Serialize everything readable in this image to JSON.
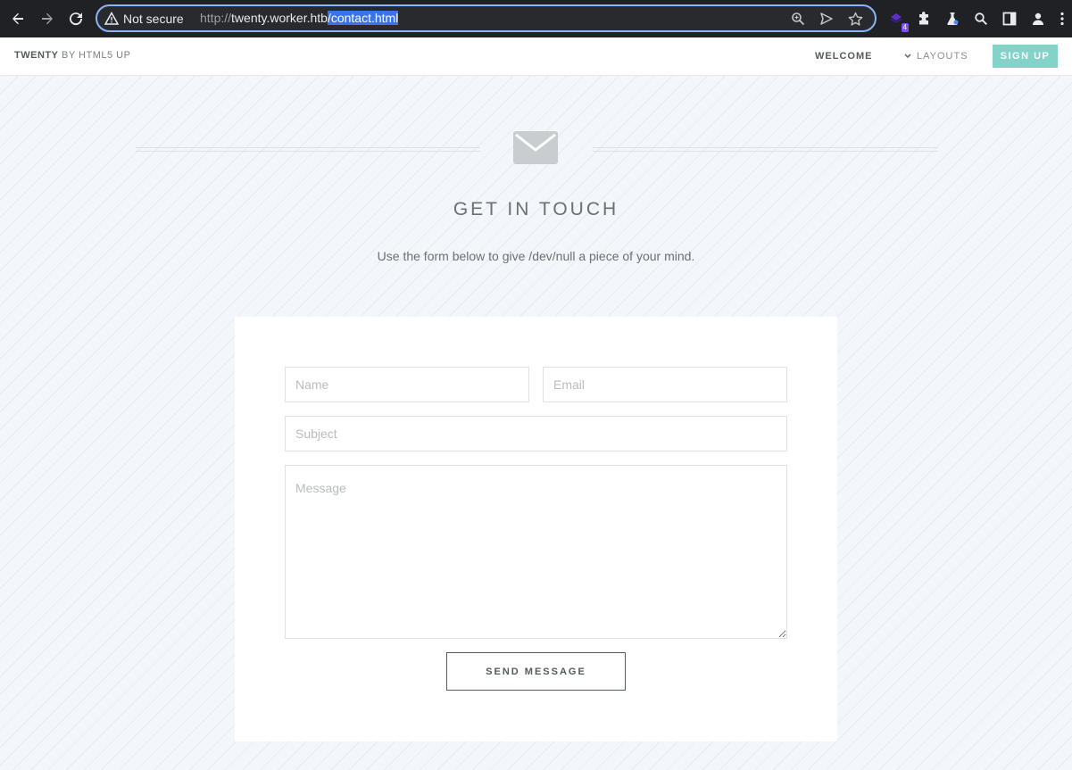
{
  "browser": {
    "security_label": "Not secure",
    "url_scheme": "http://",
    "url_host": "twenty.worker.htb",
    "url_path": "/contact.html",
    "extension_badge": "4",
    "icons": [
      "back-arrow-icon",
      "forward-arrow-icon",
      "reload-icon",
      "warning-icon",
      "zoom-icon",
      "send-icon",
      "star-icon",
      "extension-icon",
      "puzzle-icon",
      "lab-icon",
      "search-icon",
      "side-panel-icon",
      "profile-icon",
      "menu-dots-icon"
    ]
  },
  "site_header": {
    "logo_brand": "TWENTY",
    "logo_suffix": "BY HTML5 UP",
    "nav_welcome": "WELCOME",
    "nav_layouts": "LAYOUTS",
    "signup": "SIGN UP",
    "accent_color": "#83d3c9"
  },
  "main": {
    "icon": "envelope-icon",
    "heading": "GET IN TOUCH",
    "subtext": "Use the form below to give /dev/null a piece of your mind."
  },
  "form": {
    "name_placeholder": "Name",
    "email_placeholder": "Email",
    "subject_placeholder": "Subject",
    "message_placeholder": "Message",
    "name_value": "",
    "email_value": "",
    "subject_value": "",
    "message_value": "",
    "submit_label": "SEND MESSAGE"
  }
}
